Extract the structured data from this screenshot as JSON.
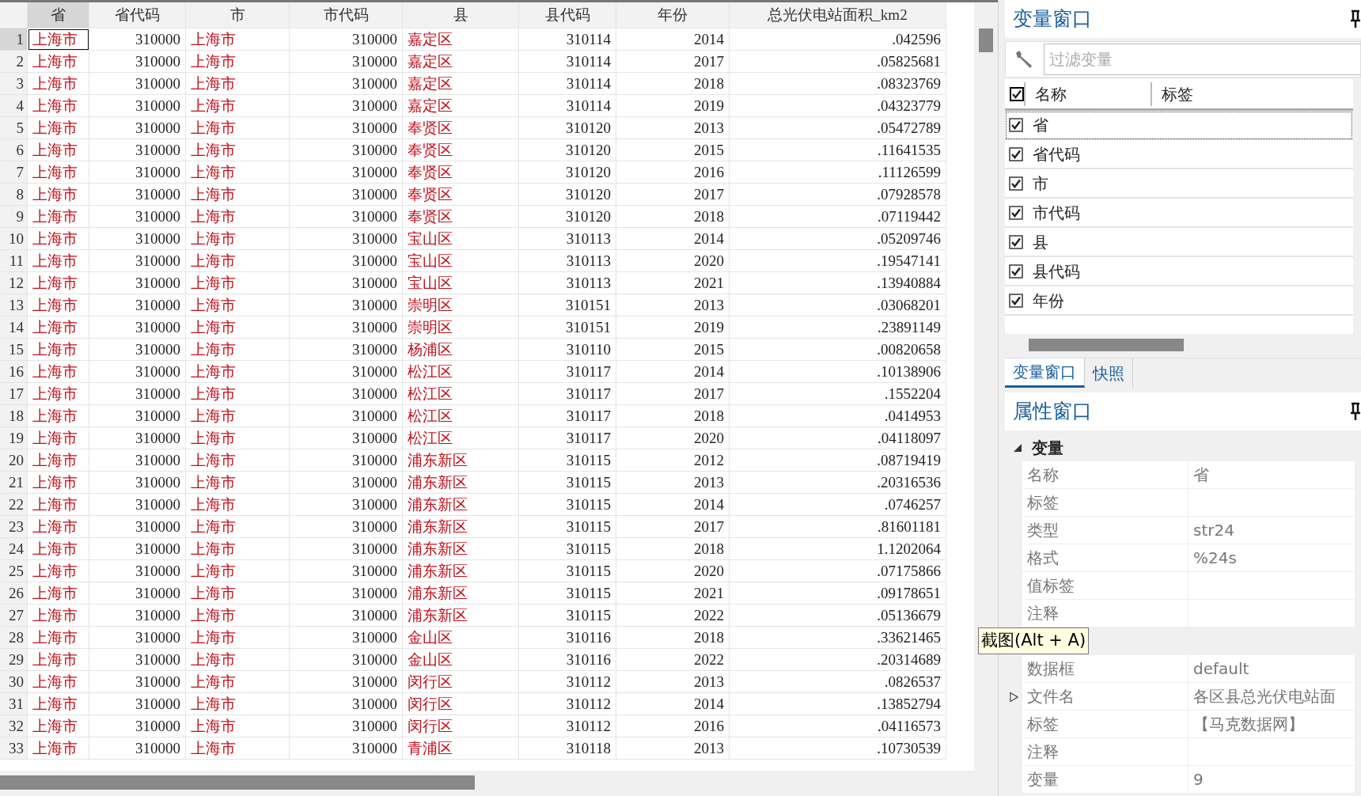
{
  "table": {
    "columns": [
      {
        "label": "省",
        "kind": "string",
        "selected": true
      },
      {
        "label": "省代码",
        "kind": "number",
        "selected": false
      },
      {
        "label": "市",
        "kind": "string",
        "selected": false
      },
      {
        "label": "市代码",
        "kind": "number",
        "selected": false
      },
      {
        "label": "县",
        "kind": "string",
        "selected": false
      },
      {
        "label": "县代码",
        "kind": "number",
        "selected": false
      },
      {
        "label": "年份",
        "kind": "number",
        "selected": false
      },
      {
        "label": "总光伏电站面积_km2",
        "kind": "number",
        "selected": false
      }
    ],
    "rows": [
      {
        "number": "1",
        "selected": true,
        "cells": [
          "上海市",
          "310000",
          "上海市",
          "310000",
          "嘉定区",
          "310114",
          "2014",
          ".042596"
        ]
      },
      {
        "number": "2",
        "selected": false,
        "cells": [
          "上海市",
          "310000",
          "上海市",
          "310000",
          "嘉定区",
          "310114",
          "2017",
          ".05825681"
        ]
      },
      {
        "number": "3",
        "selected": false,
        "cells": [
          "上海市",
          "310000",
          "上海市",
          "310000",
          "嘉定区",
          "310114",
          "2018",
          ".08323769"
        ]
      },
      {
        "number": "4",
        "selected": false,
        "cells": [
          "上海市",
          "310000",
          "上海市",
          "310000",
          "嘉定区",
          "310114",
          "2019",
          ".04323779"
        ]
      },
      {
        "number": "5",
        "selected": false,
        "cells": [
          "上海市",
          "310000",
          "上海市",
          "310000",
          "奉贤区",
          "310120",
          "2013",
          ".05472789"
        ]
      },
      {
        "number": "6",
        "selected": false,
        "cells": [
          "上海市",
          "310000",
          "上海市",
          "310000",
          "奉贤区",
          "310120",
          "2015",
          ".11641535"
        ]
      },
      {
        "number": "7",
        "selected": false,
        "cells": [
          "上海市",
          "310000",
          "上海市",
          "310000",
          "奉贤区",
          "310120",
          "2016",
          ".11126599"
        ]
      },
      {
        "number": "8",
        "selected": false,
        "cells": [
          "上海市",
          "310000",
          "上海市",
          "310000",
          "奉贤区",
          "310120",
          "2017",
          ".07928578"
        ]
      },
      {
        "number": "9",
        "selected": false,
        "cells": [
          "上海市",
          "310000",
          "上海市",
          "310000",
          "奉贤区",
          "310120",
          "2018",
          ".07119442"
        ]
      },
      {
        "number": "10",
        "selected": false,
        "cells": [
          "上海市",
          "310000",
          "上海市",
          "310000",
          "宝山区",
          "310113",
          "2014",
          ".05209746"
        ]
      },
      {
        "number": "11",
        "selected": false,
        "cells": [
          "上海市",
          "310000",
          "上海市",
          "310000",
          "宝山区",
          "310113",
          "2020",
          ".19547141"
        ]
      },
      {
        "number": "12",
        "selected": false,
        "cells": [
          "上海市",
          "310000",
          "上海市",
          "310000",
          "宝山区",
          "310113",
          "2021",
          ".13940884"
        ]
      },
      {
        "number": "13",
        "selected": false,
        "cells": [
          "上海市",
          "310000",
          "上海市",
          "310000",
          "崇明区",
          "310151",
          "2013",
          ".03068201"
        ]
      },
      {
        "number": "14",
        "selected": false,
        "cells": [
          "上海市",
          "310000",
          "上海市",
          "310000",
          "崇明区",
          "310151",
          "2019",
          ".23891149"
        ]
      },
      {
        "number": "15",
        "selected": false,
        "cells": [
          "上海市",
          "310000",
          "上海市",
          "310000",
          "杨浦区",
          "310110",
          "2015",
          ".00820658"
        ]
      },
      {
        "number": "16",
        "selected": false,
        "cells": [
          "上海市",
          "310000",
          "上海市",
          "310000",
          "松江区",
          "310117",
          "2014",
          ".10138906"
        ]
      },
      {
        "number": "17",
        "selected": false,
        "cells": [
          "上海市",
          "310000",
          "上海市",
          "310000",
          "松江区",
          "310117",
          "2017",
          ".1552204"
        ]
      },
      {
        "number": "18",
        "selected": false,
        "cells": [
          "上海市",
          "310000",
          "上海市",
          "310000",
          "松江区",
          "310117",
          "2018",
          ".0414953"
        ]
      },
      {
        "number": "19",
        "selected": false,
        "cells": [
          "上海市",
          "310000",
          "上海市",
          "310000",
          "松江区",
          "310117",
          "2020",
          ".04118097"
        ]
      },
      {
        "number": "20",
        "selected": false,
        "cells": [
          "上海市",
          "310000",
          "上海市",
          "310000",
          "浦东新区",
          "310115",
          "2012",
          ".08719419"
        ]
      },
      {
        "number": "21",
        "selected": false,
        "cells": [
          "上海市",
          "310000",
          "上海市",
          "310000",
          "浦东新区",
          "310115",
          "2013",
          ".20316536"
        ]
      },
      {
        "number": "22",
        "selected": false,
        "cells": [
          "上海市",
          "310000",
          "上海市",
          "310000",
          "浦东新区",
          "310115",
          "2014",
          ".0746257"
        ]
      },
      {
        "number": "23",
        "selected": false,
        "cells": [
          "上海市",
          "310000",
          "上海市",
          "310000",
          "浦东新区",
          "310115",
          "2017",
          ".81601181"
        ]
      },
      {
        "number": "24",
        "selected": false,
        "cells": [
          "上海市",
          "310000",
          "上海市",
          "310000",
          "浦东新区",
          "310115",
          "2018",
          "1.1202064"
        ]
      },
      {
        "number": "25",
        "selected": false,
        "cells": [
          "上海市",
          "310000",
          "上海市",
          "310000",
          "浦东新区",
          "310115",
          "2020",
          ".07175866"
        ]
      },
      {
        "number": "26",
        "selected": false,
        "cells": [
          "上海市",
          "310000",
          "上海市",
          "310000",
          "浦东新区",
          "310115",
          "2021",
          ".09178651"
        ]
      },
      {
        "number": "27",
        "selected": false,
        "cells": [
          "上海市",
          "310000",
          "上海市",
          "310000",
          "浦东新区",
          "310115",
          "2022",
          ".05136679"
        ]
      },
      {
        "number": "28",
        "selected": false,
        "cells": [
          "上海市",
          "310000",
          "上海市",
          "310000",
          "金山区",
          "310116",
          "2018",
          ".33621465"
        ]
      },
      {
        "number": "29",
        "selected": false,
        "cells": [
          "上海市",
          "310000",
          "上海市",
          "310000",
          "金山区",
          "310116",
          "2022",
          ".20314689"
        ]
      },
      {
        "number": "30",
        "selected": false,
        "cells": [
          "上海市",
          "310000",
          "上海市",
          "310000",
          "闵行区",
          "310112",
          "2013",
          ".0826537"
        ]
      },
      {
        "number": "31",
        "selected": false,
        "cells": [
          "上海市",
          "310000",
          "上海市",
          "310000",
          "闵行区",
          "310112",
          "2014",
          ".13852794"
        ]
      },
      {
        "number": "32",
        "selected": false,
        "cells": [
          "上海市",
          "310000",
          "上海市",
          "310000",
          "闵行区",
          "310112",
          "2016",
          ".04116573"
        ]
      },
      {
        "number": "33",
        "selected": false,
        "cells": [
          "上海市",
          "310000",
          "上海市",
          "310000",
          "青浦区",
          "310118",
          "2013",
          ".10730539"
        ]
      }
    ]
  },
  "variables_window": {
    "title": "变量窗口",
    "filter": {
      "placeholder": "过滤变量"
    },
    "header": {
      "checked": true,
      "columns": [
        "名称",
        "标签"
      ]
    },
    "items": [
      {
        "name": "省",
        "checked": true,
        "selected": true
      },
      {
        "name": "省代码",
        "checked": true,
        "selected": false
      },
      {
        "name": "市",
        "checked": true,
        "selected": false
      },
      {
        "name": "市代码",
        "checked": true,
        "selected": false
      },
      {
        "name": "县",
        "checked": true,
        "selected": false
      },
      {
        "name": "县代码",
        "checked": true,
        "selected": false
      },
      {
        "name": "年份",
        "checked": true,
        "selected": false
      }
    ],
    "tabs": [
      {
        "label": "变量窗口",
        "selected": true
      },
      {
        "label": "快照",
        "selected": false
      }
    ]
  },
  "properties_window": {
    "title": "属性窗口",
    "sections": [
      {
        "title": "变量",
        "expanded": true,
        "rows": [
          {
            "name": "名称",
            "value": "省"
          },
          {
            "name": "标签"
          },
          {
            "name": "类型",
            "value": "str24"
          },
          {
            "name": "格式",
            "value": "%24s"
          },
          {
            "name": "值标签"
          },
          {
            "name": "注释"
          }
        ]
      },
      {
        "rows": [
          {
            "name": "数据框",
            "value": "default"
          },
          {
            "name": "文件名",
            "value": "各区县总光伏电站面",
            "expandable": true
          },
          {
            "name": "标签",
            "value": "【马克数据网】"
          },
          {
            "name": "注释"
          },
          {
            "name": "变量",
            "value": "9"
          }
        ]
      }
    ]
  },
  "tooltip": "截图(Alt + A)"
}
